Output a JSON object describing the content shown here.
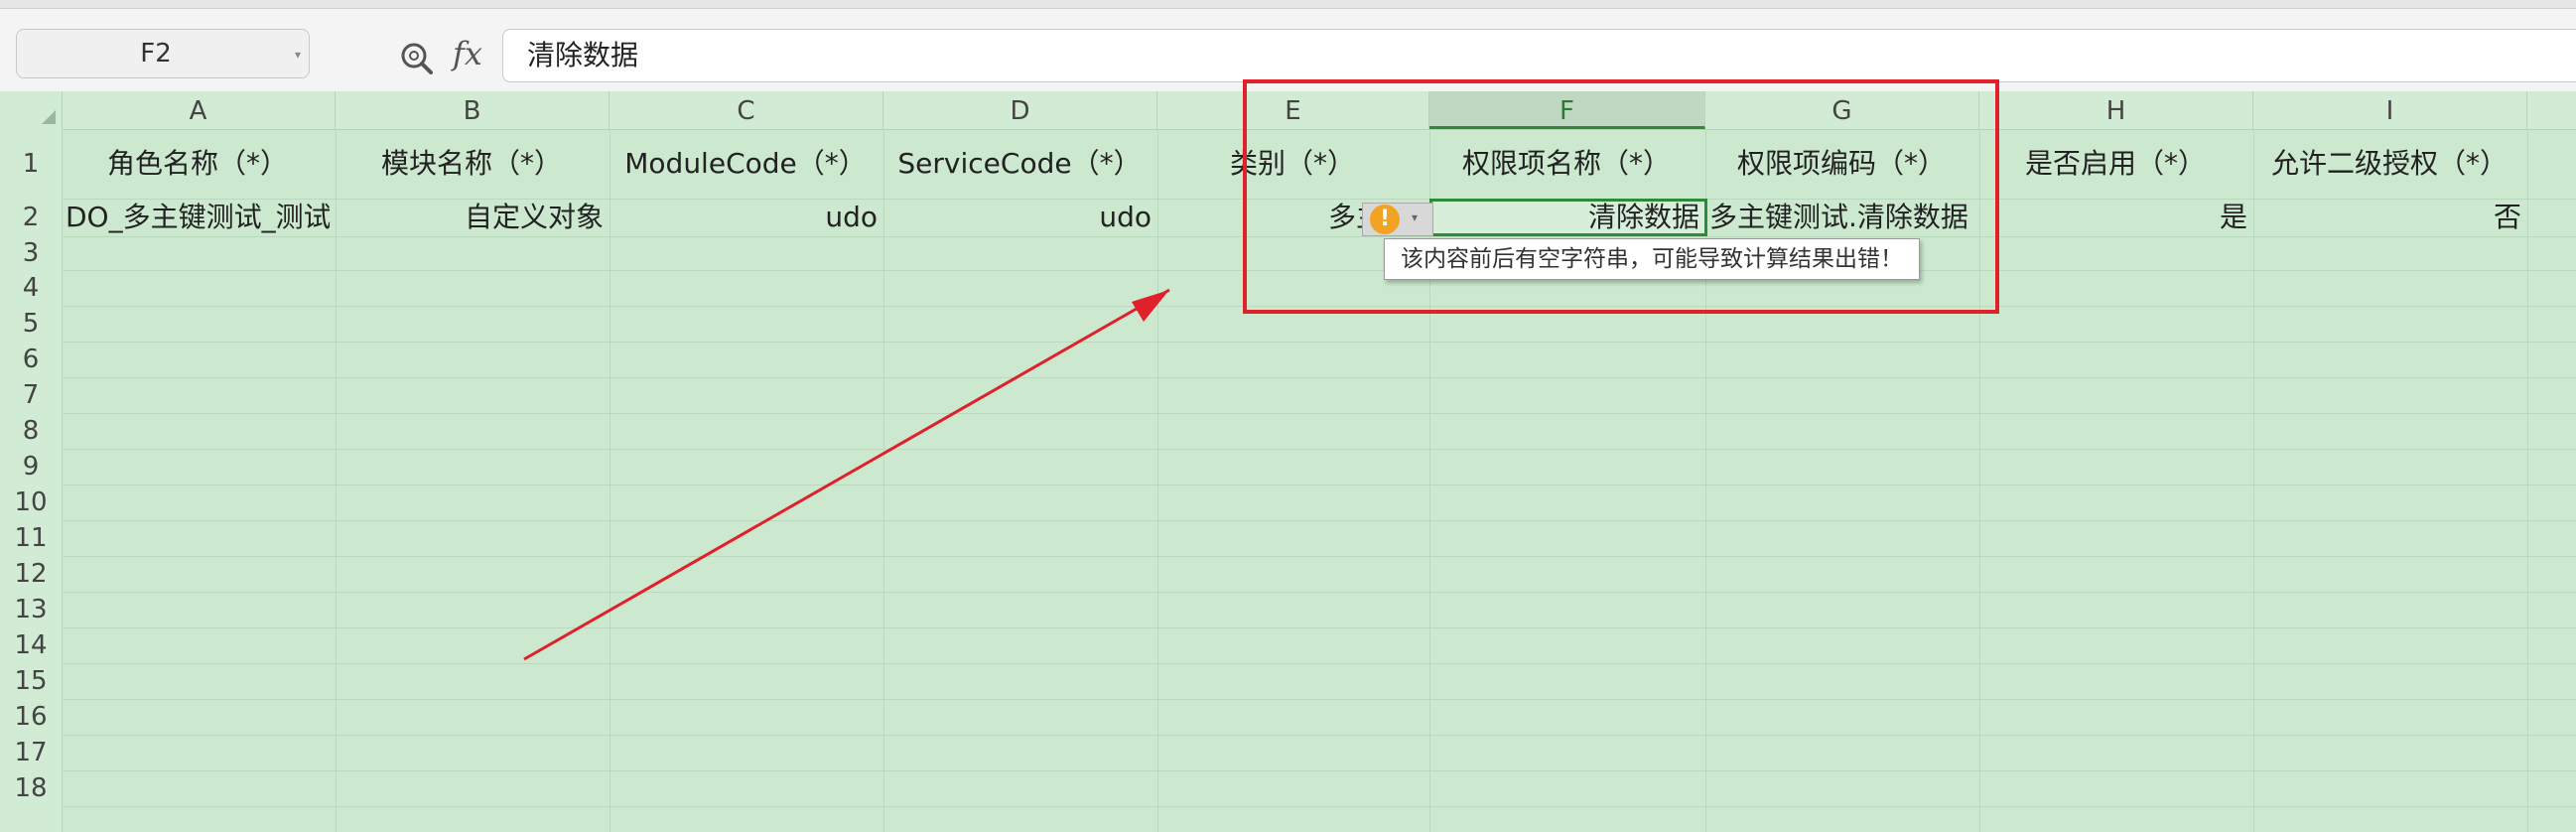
{
  "formula_bar": {
    "name_box": "F2",
    "fx_label": "fx",
    "formula": "清除数据"
  },
  "columns": [
    "A",
    "B",
    "C",
    "D",
    "E",
    "F",
    "G",
    "H",
    "I"
  ],
  "selected_column": "F",
  "rows": [
    "1",
    "2",
    "3",
    "4",
    "5",
    "6",
    "7",
    "8",
    "9",
    "10",
    "11",
    "12",
    "13",
    "14",
    "15",
    "16",
    "17",
    "18"
  ],
  "headers": [
    "角色名称（*）",
    "模块名称（*）",
    "ModuleCode（*）",
    "ServiceCode（*）",
    "类别（*）",
    "权限项名称（*）",
    "权限项编码（*）",
    "是否启用（*）",
    "允许二级授权（*）"
  ],
  "row2": {
    "A": "DO_多主键测试_测试",
    "B": "自定义对象",
    "C": "udo",
    "D": "udo",
    "E": "多主键",
    "F": "清除数据",
    "G": "多主键测试.清除数据",
    "H": "是",
    "I": "否"
  },
  "warning": {
    "icon": "!",
    "tooltip": "该内容前后有空字符串，可能导致计算结果出错！"
  },
  "colors": {
    "sheet_bg": "#cce8cf",
    "selection": "#2d8c3a",
    "annotation_red": "#e0202a",
    "warning": "#f2a324"
  }
}
